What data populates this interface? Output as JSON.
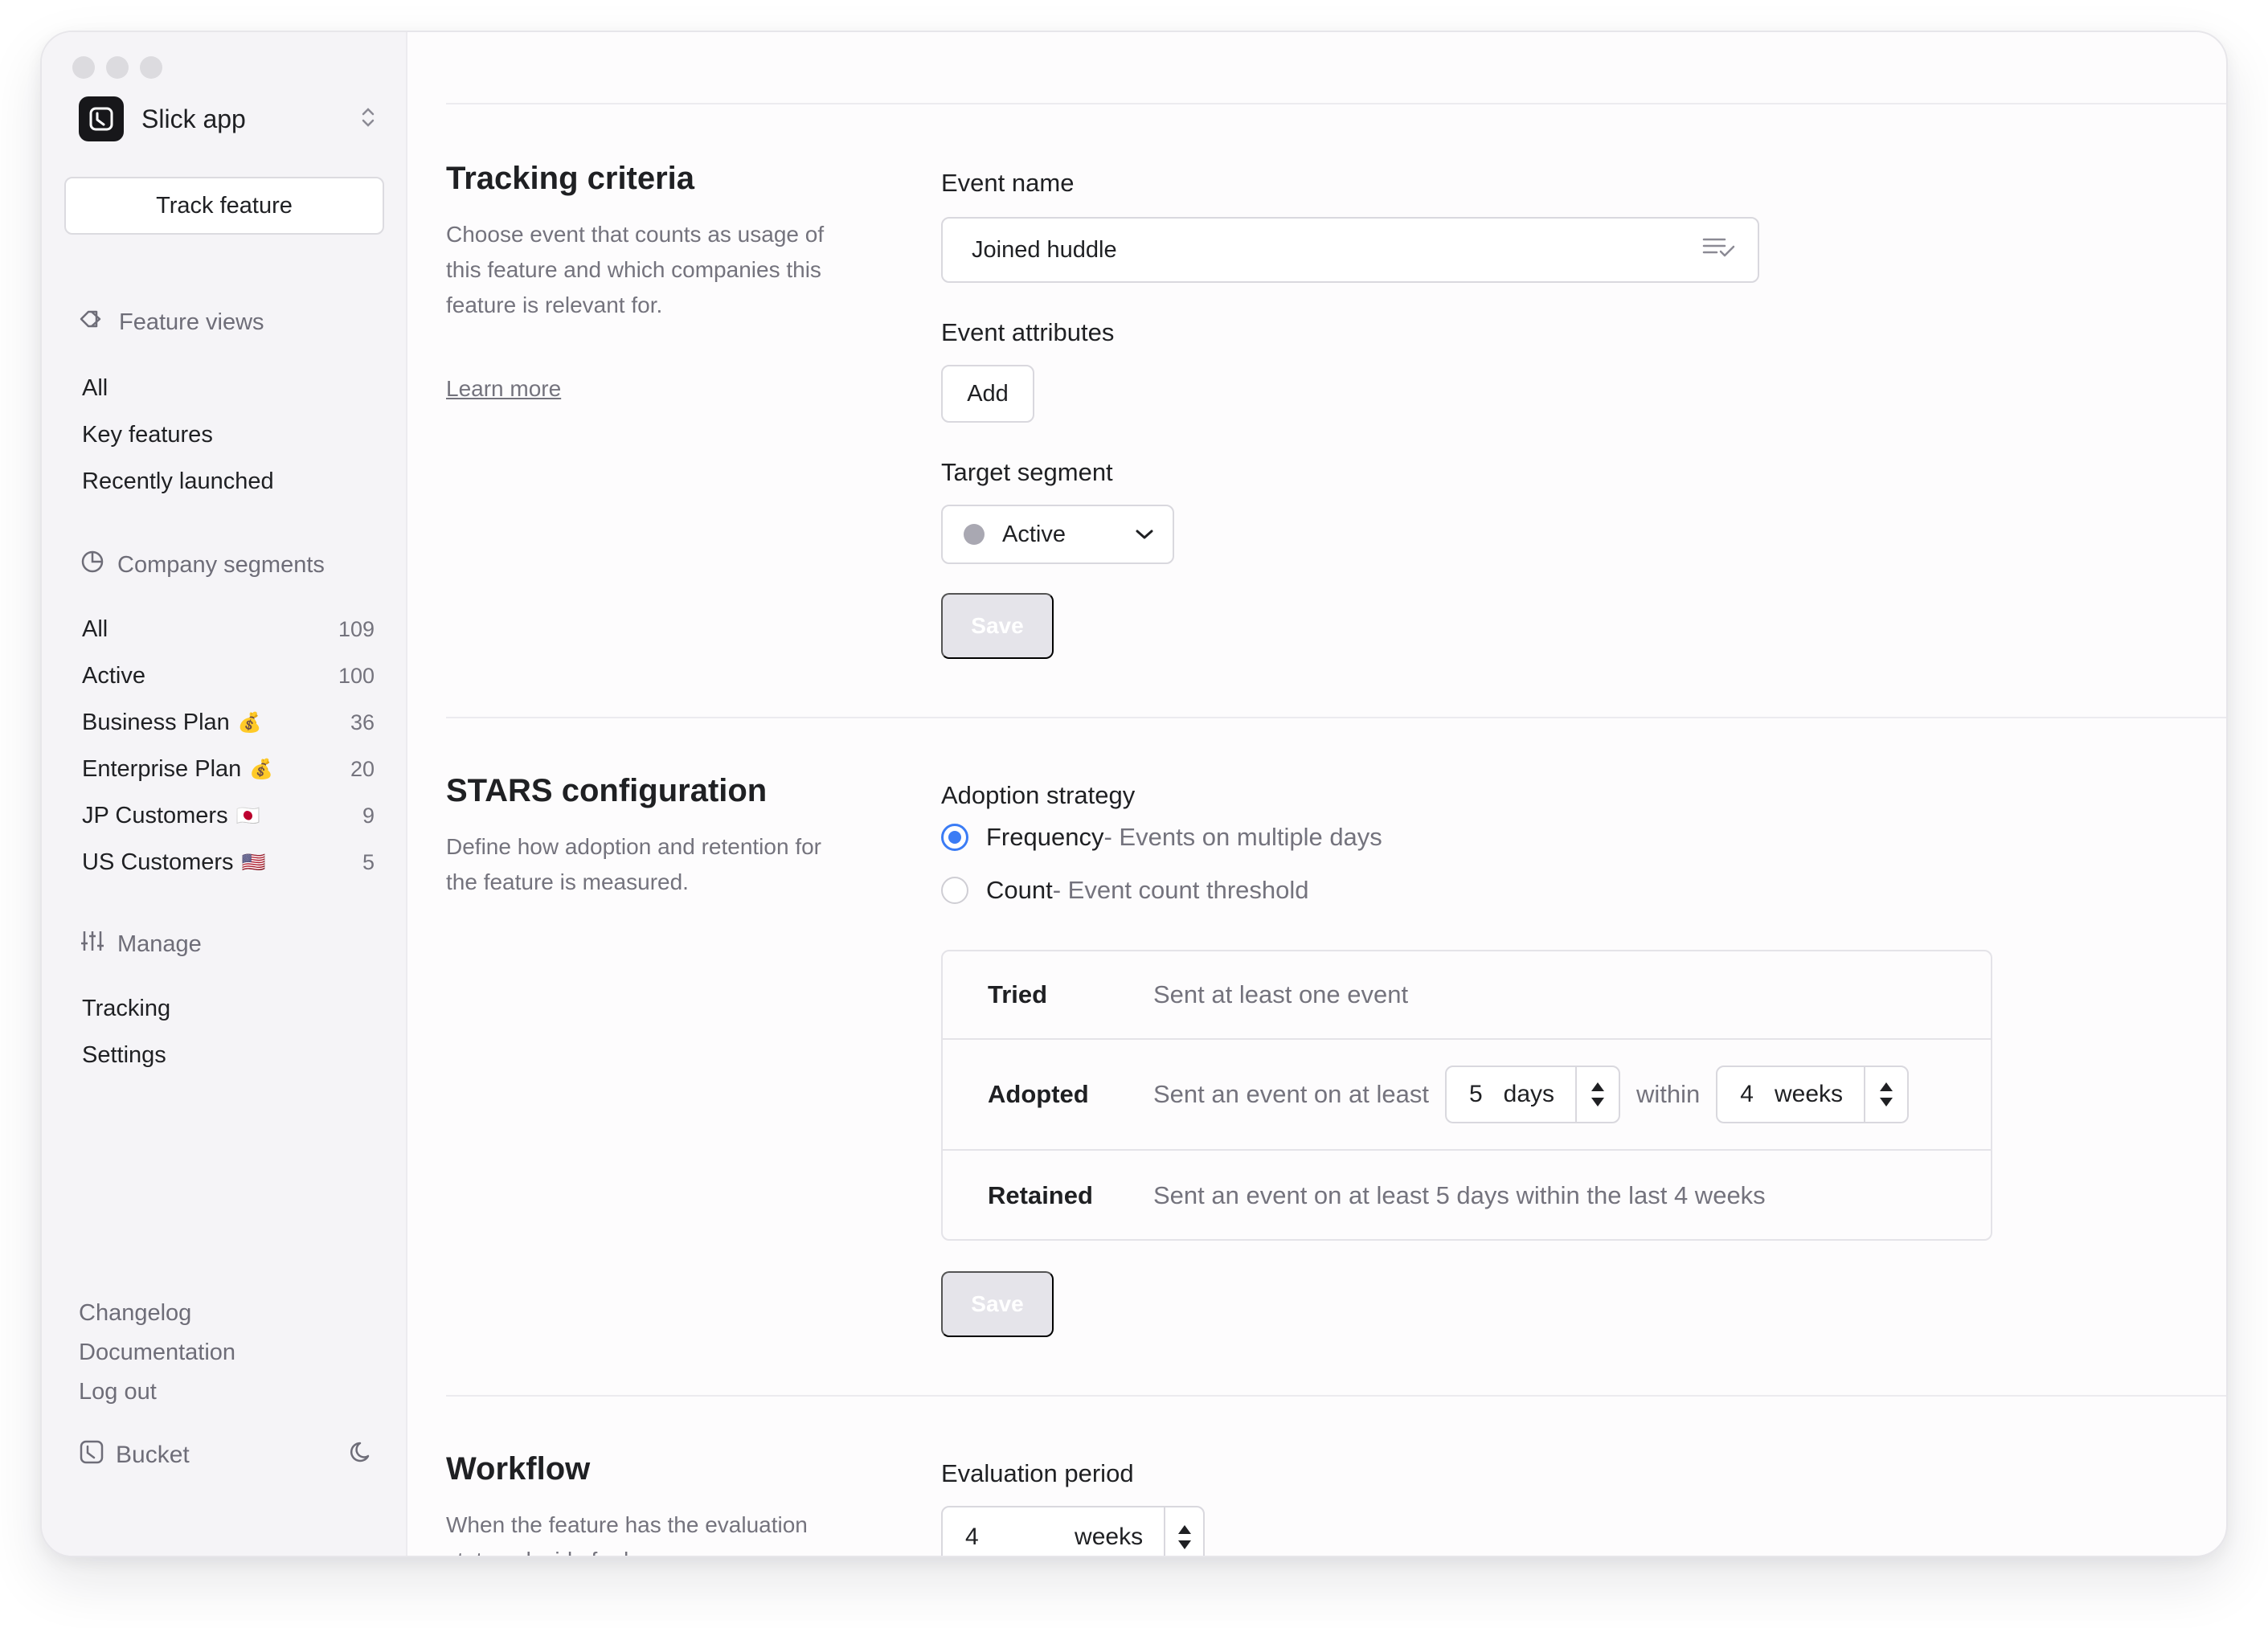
{
  "sidebar": {
    "app_name": "Slick app",
    "track_button": "Track feature",
    "feature_views": {
      "title": "Feature views",
      "items": [
        {
          "label": "All"
        },
        {
          "label": "Key features"
        },
        {
          "label": "Recently launched"
        }
      ]
    },
    "company_segments": {
      "title": "Company segments",
      "items": [
        {
          "label": "All",
          "count": "109",
          "emoji": ""
        },
        {
          "label": "Active",
          "count": "100",
          "emoji": ""
        },
        {
          "label": "Business Plan",
          "count": "36",
          "emoji": "💰"
        },
        {
          "label": "Enterprise Plan",
          "count": "20",
          "emoji": "💰"
        },
        {
          "label": "JP Customers",
          "count": "9",
          "emoji": "🇯🇵"
        },
        {
          "label": "US Customers",
          "count": "5",
          "emoji": "🇺🇸"
        }
      ]
    },
    "manage": {
      "title": "Manage",
      "items": [
        {
          "label": "Tracking"
        },
        {
          "label": "Settings"
        }
      ]
    },
    "footer_links": [
      "Changelog",
      "Documentation",
      "Log out"
    ],
    "bucket_label": "Bucket"
  },
  "tracking": {
    "title": "Tracking criteria",
    "description": "Choose event that counts as usage of this feature and which companies this feature is relevant for.",
    "learn_more": "Learn more",
    "event_name_label": "Event name",
    "event_name_value": "Joined huddle",
    "event_attributes_label": "Event attributes",
    "add_button": "Add",
    "target_segment_label": "Target segment",
    "target_segment_value": "Active",
    "save_button": "Save"
  },
  "stars": {
    "title": "STARS configuration",
    "description": "Define how adoption and retention for the feature is measured.",
    "strategy_label": "Adoption strategy",
    "options": [
      {
        "label": "Frequency",
        "sub": " - Events on multiple days",
        "selected": true
      },
      {
        "label": "Count",
        "sub": " - Event count threshold",
        "selected": false
      }
    ],
    "rows": {
      "tried": {
        "name": "Tried",
        "desc": "Sent at least one event"
      },
      "adopted": {
        "name": "Adopted",
        "desc": "Sent an event on at least",
        "days_value": "5",
        "days_unit": "days",
        "within": "within",
        "weeks_value": "4",
        "weeks_unit": "weeks"
      },
      "retained": {
        "name": "Retained",
        "desc": "Sent an event on at least 5 days within the last 4 weeks"
      }
    },
    "save_button": "Save"
  },
  "workflow": {
    "title": "Workflow",
    "description": "When the feature has the evaluation status, decide for how",
    "evaluation_label": "Evaluation period",
    "evaluation_value": "4",
    "evaluation_unit": "weeks"
  },
  "colors": {
    "accent": "#3b7cf5",
    "sidebar_bg": "#f5f4f7",
    "muted_text": "#74737d"
  }
}
